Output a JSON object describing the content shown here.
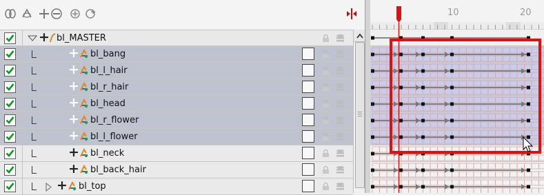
{
  "toolbar": {
    "icons": [
      "onion-skin-icon",
      "onion-skin-alt-icon",
      "expand-all-icon",
      "collapse-all-icon",
      "add-layer-icon",
      "add-peg-icon",
      "timeline-split-icon"
    ]
  },
  "ruler": {
    "labels": [
      "10",
      "20"
    ]
  },
  "layers": [
    {
      "name": "bl_MASTER",
      "selected": false,
      "checked": true
    },
    {
      "name": "bl_bang",
      "selected": true,
      "checked": true
    },
    {
      "name": "bl_l_hair",
      "selected": true,
      "checked": true
    },
    {
      "name": "bl_r_hair",
      "selected": true,
      "checked": true
    },
    {
      "name": "bl_head",
      "selected": true,
      "checked": true
    },
    {
      "name": "bl_r_flower",
      "selected": true,
      "checked": true
    },
    {
      "name": "bl_l_flower",
      "selected": true,
      "checked": true
    },
    {
      "name": "bl_neck",
      "selected": false,
      "checked": true
    },
    {
      "name": "bl_back_hair",
      "selected": false,
      "checked": true
    },
    {
      "name": "bl_top",
      "selected": false,
      "checked": true
    }
  ],
  "colors": {
    "selection_highlight": "#bfc2cf",
    "playhead": "#e01010",
    "annotation_box": "#e01010",
    "checkbox_green": "#0a9a1e"
  }
}
